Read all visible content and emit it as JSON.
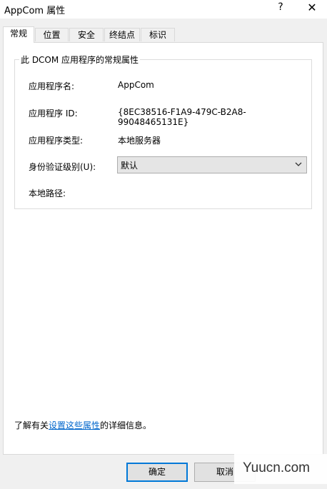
{
  "window": {
    "title": "AppCom 属性",
    "help_label": "?",
    "close_label": "✕"
  },
  "tabs": [
    {
      "label": "常规",
      "active": true
    },
    {
      "label": "位置",
      "active": false
    },
    {
      "label": "安全",
      "active": false
    },
    {
      "label": "终结点",
      "active": false
    },
    {
      "label": "标识",
      "active": false
    }
  ],
  "general": {
    "group_title": "此 DCOM 应用程序的常规属性",
    "fields": [
      {
        "label": "应用程序名:",
        "value": "AppCom"
      },
      {
        "label": "应用程序 ID:",
        "value": "{8EC38516-F1A9-479C-B2A8-99048465131E}"
      },
      {
        "label": "应用程序类型:",
        "value": "本地服务器"
      }
    ],
    "auth": {
      "label": "身份验证级别(U):",
      "selected": "默认"
    },
    "local_path": {
      "label": "本地路径:",
      "value": ""
    }
  },
  "footer": {
    "prefix": "了解有关",
    "link": "设置这些属性",
    "suffix": "的详细信息。"
  },
  "buttons": {
    "ok": "确定",
    "cancel": "取消"
  },
  "watermark": "Yuucn.com"
}
